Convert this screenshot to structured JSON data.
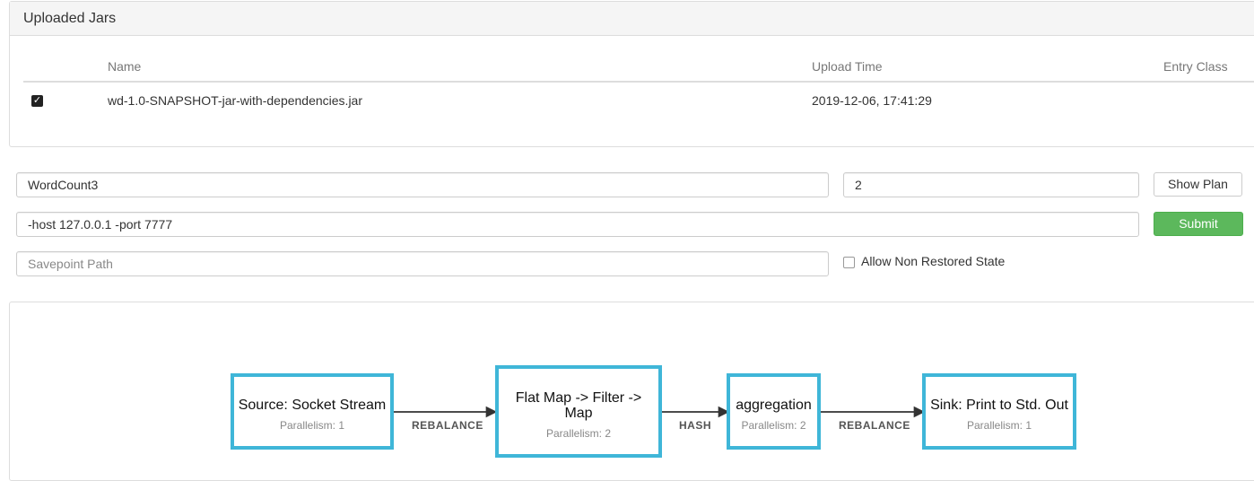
{
  "jars_panel": {
    "heading": "Uploaded Jars",
    "columns": {
      "name": "Name",
      "upload_time": "Upload Time",
      "entry_class": "Entry Class"
    },
    "rows": [
      {
        "checked": true,
        "name": "wd-1.0-SNAPSHOT-jar-with-dependencies.jar",
        "upload_time": "2019-12-06, 17:41:29",
        "entry_class": ""
      }
    ]
  },
  "submit_form": {
    "entry_class_value": "WordCount3",
    "parallelism_value": "2",
    "program_args_value": "-host 127.0.0.1 -port 7777",
    "savepoint_placeholder": "Savepoint Path",
    "show_plan_label": "Show Plan",
    "submit_label": "Submit",
    "allow_non_restored_label": "Allow Non Restored State",
    "allow_non_restored_checked": false
  },
  "plan": {
    "nodes": [
      {
        "title": "Source: Socket Stream",
        "parallelism": "Parallelism: 1"
      },
      {
        "title": "Flat Map -> Filter -> Map",
        "parallelism": "Parallelism: 2"
      },
      {
        "title": "aggregation",
        "parallelism": "Parallelism: 2"
      },
      {
        "title": "Sink: Print to Std. Out",
        "parallelism": "Parallelism: 1"
      }
    ],
    "edges": [
      {
        "label": "REBALANCE"
      },
      {
        "label": "HASH"
      },
      {
        "label": "REBALANCE"
      }
    ]
  },
  "colors": {
    "node_border": "#3fb6d8",
    "submit_bg": "#5cb85c",
    "panel_heading_bg": "#f5f5f5"
  }
}
